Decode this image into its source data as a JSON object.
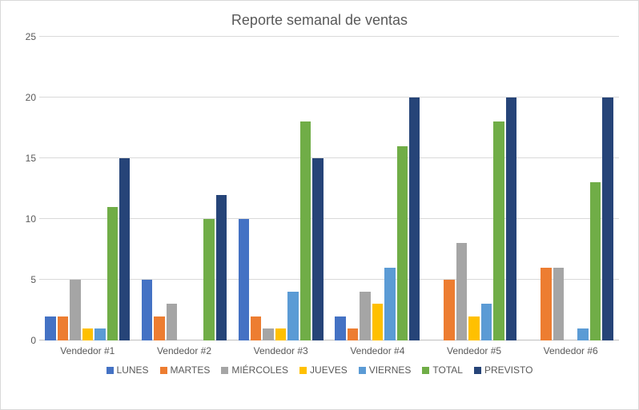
{
  "chart_data": {
    "type": "bar",
    "title": "Reporte semanal de ventas",
    "categories": [
      "Vendedor #1",
      "Vendedor #2",
      "Vendedor #3",
      "Vendedor #4",
      "Vendedor #5",
      "Vendedor #6"
    ],
    "series": [
      {
        "name": "LUNES",
        "color": "#4472C4",
        "values": [
          2,
          5,
          10,
          2,
          0,
          0
        ]
      },
      {
        "name": "MARTES",
        "color": "#ED7D31",
        "values": [
          2,
          2,
          2,
          1,
          5,
          6
        ]
      },
      {
        "name": "MIÉRCOLES",
        "color": "#A5A5A5",
        "values": [
          5,
          3,
          1,
          4,
          8,
          6
        ]
      },
      {
        "name": "JUEVES",
        "color": "#FFC000",
        "values": [
          1,
          0,
          1,
          3,
          2,
          0
        ]
      },
      {
        "name": "VIERNES",
        "color": "#5B9BD5",
        "values": [
          1,
          0,
          4,
          6,
          3,
          1
        ]
      },
      {
        "name": "TOTAL",
        "color": "#70AD47",
        "values": [
          11,
          10,
          18,
          16,
          18,
          13
        ]
      },
      {
        "name": "PREVISTO",
        "color": "#264478",
        "values": [
          15,
          12,
          15,
          20,
          20,
          20
        ]
      }
    ],
    "ylim": [
      0,
      25
    ],
    "yticks": [
      0,
      5,
      10,
      15,
      20,
      25
    ],
    "xlabel": "",
    "ylabel": ""
  }
}
